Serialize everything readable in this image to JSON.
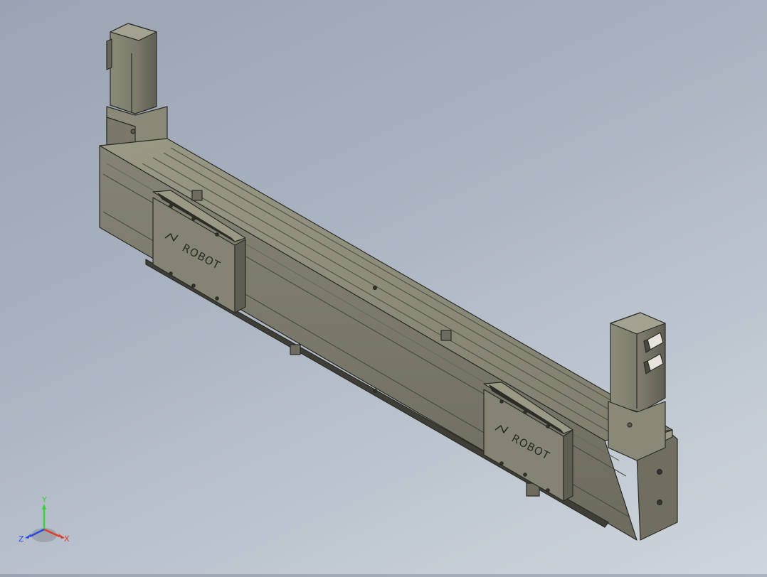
{
  "model": {
    "brand_logo_text": "ROBOT",
    "body_color": "#7b7a6b",
    "edge_color": "#2b2b26"
  },
  "triad": {
    "x_label": "X",
    "y_label": "Y",
    "z_label": "Z",
    "x_color": "#e23a2a",
    "y_color": "#3ad13a",
    "z_color": "#2a4ae2"
  }
}
